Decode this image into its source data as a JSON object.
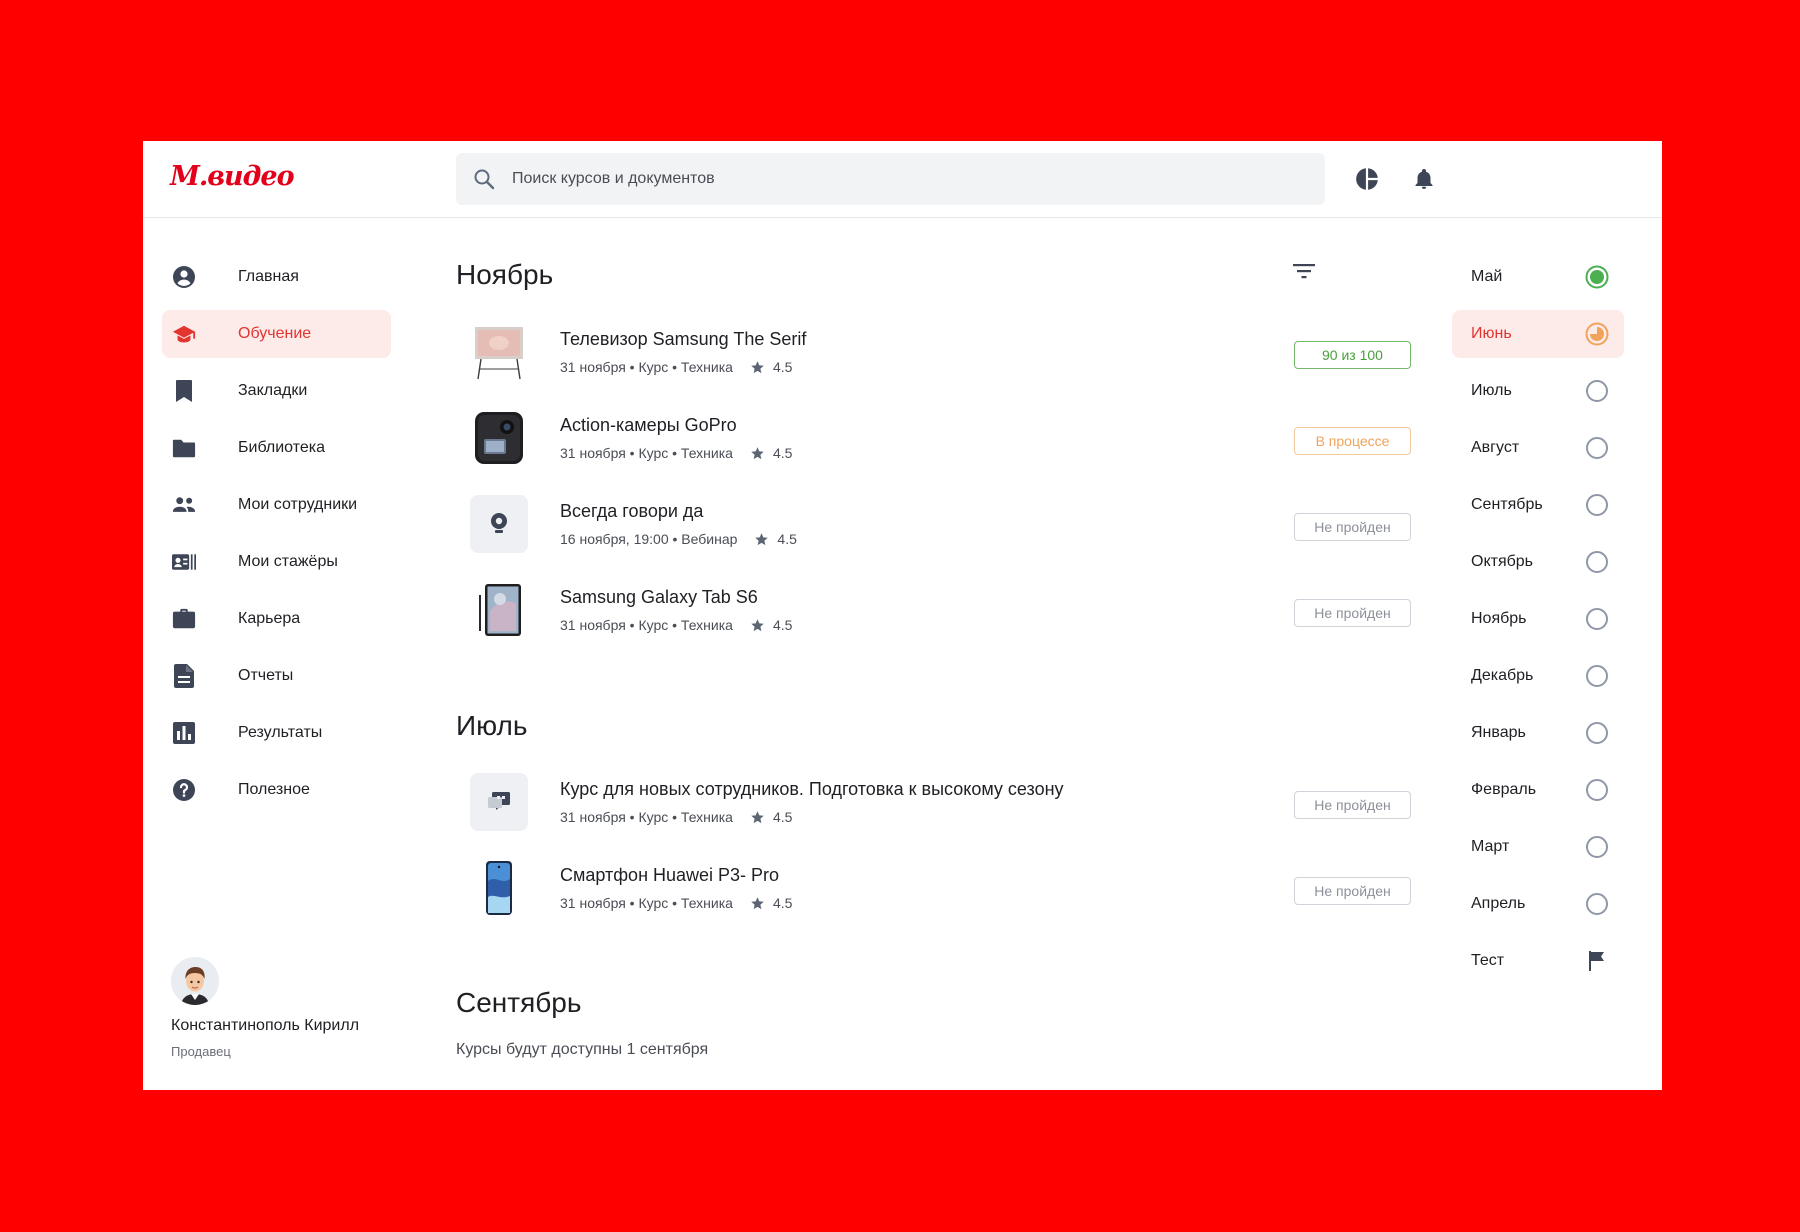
{
  "brand": {
    "logo_text": "М.видео",
    "accent_color": "#e3001b"
  },
  "search": {
    "placeholder": "Поиск курсов и документов",
    "icon": "search-icon"
  },
  "header": {
    "icons": [
      "pie-chart-icon",
      "bell-icon"
    ]
  },
  "sidebar": {
    "items": [
      {
        "label": "Главная",
        "icon": "account-circle-icon",
        "active": false
      },
      {
        "label": "Обучение",
        "icon": "graduation-cap-icon",
        "active": true
      },
      {
        "label": "Закладки",
        "icon": "bookmark-icon",
        "active": false
      },
      {
        "label": "Библиотека",
        "icon": "folder-icon",
        "active": false
      },
      {
        "label": "Мои сотрудники",
        "icon": "people-icon",
        "active": false
      },
      {
        "label": "Мои стажёры",
        "icon": "badge-list-icon",
        "active": false
      },
      {
        "label": "Карьера",
        "icon": "briefcase-icon",
        "active": false
      },
      {
        "label": "Отчеты",
        "icon": "document-icon",
        "active": false
      },
      {
        "label": "Результаты",
        "icon": "bar-chart-icon",
        "active": false
      },
      {
        "label": "Полезное",
        "icon": "help-icon",
        "active": false
      }
    ]
  },
  "user": {
    "name": "Константинополь Кирилл",
    "role": "Продавец"
  },
  "main": {
    "sections": [
      {
        "title": "Ноябрь",
        "courses": [
          {
            "title": "Телевизор Samsung The Serif",
            "meta": "31 ноября • Курс • Техника",
            "rating": "4.5",
            "status": "90 из 100",
            "status_type": "done",
            "thumb": "tv-icon"
          },
          {
            "title": "Action-камеры GoPro",
            "meta": "31 ноября • Курс • Техника",
            "rating": "4.5",
            "status": "В процессе",
            "status_type": "progress",
            "thumb": "camera-icon"
          },
          {
            "title": "Всегда говори да",
            "meta": "16 ноября, 19:00 • Вебинар",
            "rating": "4.5",
            "status": "Не пройден",
            "status_type": "none",
            "thumb": "webcam-icon"
          },
          {
            "title": "Samsung Galaxy Tab S6",
            "meta": "31 ноября • Курс • Техника",
            "rating": "4.5",
            "status": "Не пройден",
            "status_type": "none",
            "thumb": "tablet-icon"
          }
        ]
      },
      {
        "title": "Июль",
        "courses": [
          {
            "title": "Курс для новых сотрудников. Подготовка к высокому сезону",
            "meta": "31 ноября • Курс • Техника",
            "rating": "4.5",
            "status": "Не пройден",
            "status_type": "none",
            "thumb": "chat-icon"
          },
          {
            "title": "Смартфон Huawei P3- Pro",
            "meta": "31 ноября • Курс • Техника",
            "rating": "4.5",
            "status": "Не пройден",
            "status_type": "none",
            "thumb": "phone-icon"
          }
        ]
      },
      {
        "title": "Сентябрь",
        "note": "Курсы будут доступны 1 сентября"
      }
    ]
  },
  "months": [
    {
      "label": "Май",
      "state": "complete"
    },
    {
      "label": "Июнь",
      "state": "in-progress"
    },
    {
      "label": "Июль",
      "state": "empty"
    },
    {
      "label": "Август",
      "state": "empty"
    },
    {
      "label": "Сентябрь",
      "state": "empty"
    },
    {
      "label": "Октябрь",
      "state": "empty"
    },
    {
      "label": "Ноябрь",
      "state": "empty"
    },
    {
      "label": "Декабрь",
      "state": "empty"
    },
    {
      "label": "Январь",
      "state": "empty"
    },
    {
      "label": "Февраль",
      "state": "empty"
    },
    {
      "label": "Март",
      "state": "empty"
    },
    {
      "label": "Апрель",
      "state": "empty"
    },
    {
      "label": "Тест",
      "state": "flag"
    }
  ],
  "colors": {
    "green": "#4caf50",
    "orange": "#f0a35b",
    "nav_icon": "#3d4556",
    "active_bg": "#fdebea",
    "active_text": "#e2352f"
  }
}
